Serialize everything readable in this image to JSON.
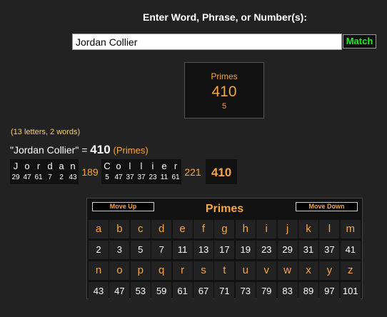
{
  "header": {
    "prompt": "Enter Word, Phrase, or Number(s):"
  },
  "search": {
    "value": "Jordan Collier",
    "match_label": "Match"
  },
  "summary": {
    "cipher": "Primes",
    "value": "410",
    "reduction": "5"
  },
  "result": {
    "counts": "(13 letters, 2 words)",
    "phrase_quoted": "\"Jordan Collier\"",
    "equals": " = ",
    "value": "410",
    "cipher_label": "(Primes)"
  },
  "breakdown": {
    "words": [
      {
        "letters": [
          "J",
          "o",
          "r",
          "d",
          "a",
          "n"
        ],
        "values": [
          "29",
          "47",
          "61",
          "7",
          "2",
          "43"
        ],
        "sum": "189"
      },
      {
        "letters": [
          "C",
          "o",
          "l",
          "l",
          "i",
          "e",
          "r"
        ],
        "values": [
          "5",
          "47",
          "37",
          "37",
          "23",
          "11",
          "61"
        ],
        "sum": "221"
      }
    ],
    "total": "410"
  },
  "cipher_table": {
    "title": "Primes",
    "move_up_label": "Move Up",
    "move_down_label": "Move Down",
    "rows": [
      {
        "letters": [
          "a",
          "b",
          "c",
          "d",
          "e",
          "f",
          "g",
          "h",
          "i",
          "j",
          "k",
          "l",
          "m"
        ],
        "values": [
          "2",
          "3",
          "5",
          "7",
          "11",
          "13",
          "17",
          "19",
          "23",
          "29",
          "31",
          "37",
          "41"
        ]
      },
      {
        "letters": [
          "n",
          "o",
          "p",
          "q",
          "r",
          "s",
          "t",
          "u",
          "v",
          "w",
          "x",
          "y",
          "z"
        ],
        "values": [
          "43",
          "47",
          "53",
          "59",
          "61",
          "67",
          "71",
          "73",
          "79",
          "83",
          "89",
          "97",
          "101"
        ]
      }
    ]
  },
  "colors": {
    "background": "#222222",
    "accent": "#f7a545",
    "match_green": "#28e828"
  }
}
